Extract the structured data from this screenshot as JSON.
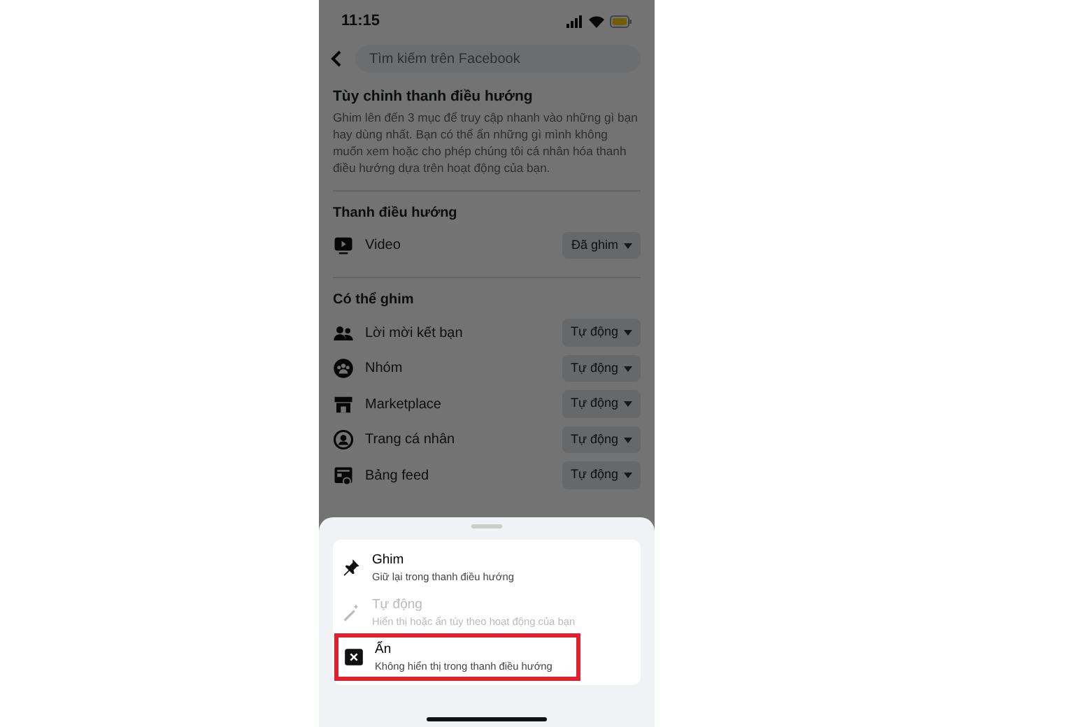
{
  "status_bar": {
    "time": "11:15"
  },
  "search": {
    "placeholder": "Tìm kiếm trên Facebook"
  },
  "intro": {
    "title": "Tùy chỉnh thanh điều hướng",
    "text": "Ghim lên đến 3 mục để truy cập nhanh vào những gì bạn hay dùng nhất. Bạn có thể ẩn những gì mình không muốn xem hoặc cho phép chúng tôi cá nhân hóa thanh điều hướng dựa trên hoạt động của bạn."
  },
  "sections": [
    {
      "title": "Thanh điều hướng",
      "items": [
        {
          "kind": "video",
          "label": "Video",
          "status": "Đã ghim"
        }
      ]
    },
    {
      "title": "Có thể ghim",
      "items": [
        {
          "kind": "friends",
          "label": "Lời mời kết bạn",
          "status": "Tự động"
        },
        {
          "kind": "groups",
          "label": "Nhóm",
          "status": "Tự động"
        },
        {
          "kind": "marketplace",
          "label": "Marketplace",
          "status": "Tự động"
        },
        {
          "kind": "profile",
          "label": "Trang cá nhân",
          "status": "Tự động"
        },
        {
          "kind": "feed",
          "label": "Bảng feed",
          "status": "Tự động"
        }
      ]
    }
  ],
  "sheet": {
    "options": [
      {
        "kind": "pin",
        "title": "Ghim",
        "subtitle": "Giữ lại trong thanh điều hướng",
        "disabled": false,
        "highlighted": false
      },
      {
        "kind": "auto",
        "title": "Tự động",
        "subtitle": "Hiển thị hoặc ẩn tùy theo hoạt động của bạn",
        "disabled": true,
        "highlighted": false
      },
      {
        "kind": "hide",
        "title": "Ẩn",
        "subtitle": "Không hiển thị trong thanh điều hướng",
        "disabled": false,
        "highlighted": true
      }
    ]
  }
}
